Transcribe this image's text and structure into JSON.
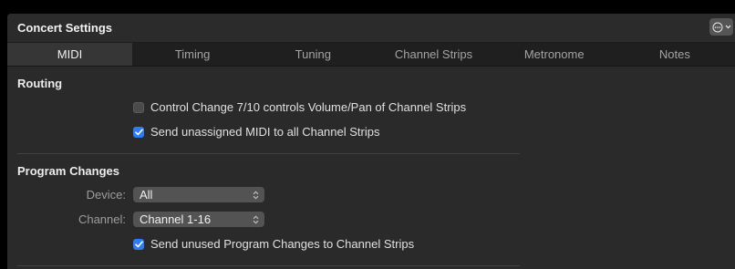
{
  "window": {
    "title": "Concert Settings"
  },
  "toolbar": {
    "more_icon": "ellipsis-circle-icon",
    "chevron_icon": "chevron-down-icon"
  },
  "tabs": [
    {
      "label": "MIDI",
      "active": true
    },
    {
      "label": "Timing"
    },
    {
      "label": "Tuning"
    },
    {
      "label": "Channel Strips"
    },
    {
      "label": "Metronome"
    },
    {
      "label": "Notes"
    }
  ],
  "routing": {
    "title": "Routing",
    "cc_label": "Control Change 7/10 controls Volume/Pan of Channel Strips",
    "cc_checked": false,
    "send_unassigned_label": "Send unassigned MIDI to all Channel Strips",
    "send_unassigned_checked": true
  },
  "program_changes": {
    "title": "Program Changes",
    "device_label": "Device:",
    "device_value": "All",
    "channel_label": "Channel:",
    "channel_value": "Channel 1-16",
    "send_unused_label": "Send unused Program Changes to Channel Strips",
    "send_unused_checked": true
  },
  "colors": {
    "accent": "#2e7bf6",
    "background": "#2a2a2a"
  }
}
